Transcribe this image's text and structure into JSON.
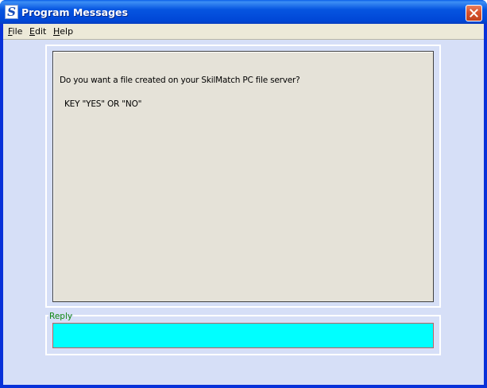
{
  "window": {
    "title": "Program Messages",
    "icon": "S"
  },
  "menu": {
    "items": [
      {
        "accel": "F",
        "rest": "ile"
      },
      {
        "accel": "E",
        "rest": "dit"
      },
      {
        "accel": "H",
        "rest": "elp"
      }
    ]
  },
  "message": {
    "lines": [
      "Do you want a file created on your SkilMatch PC file server?",
      "KEY \"YES\" OR \"NO\""
    ]
  },
  "reply": {
    "label": "Reply",
    "value": ""
  },
  "colors": {
    "titlebar": "#0054e3",
    "client_bg": "#d6dff7",
    "message_bg": "#e5e2d8",
    "reply_bg": "#00ffff",
    "reply_label": "#118811"
  },
  "icons": {
    "app": "skilmatch-app-icon",
    "close": "close-icon"
  }
}
